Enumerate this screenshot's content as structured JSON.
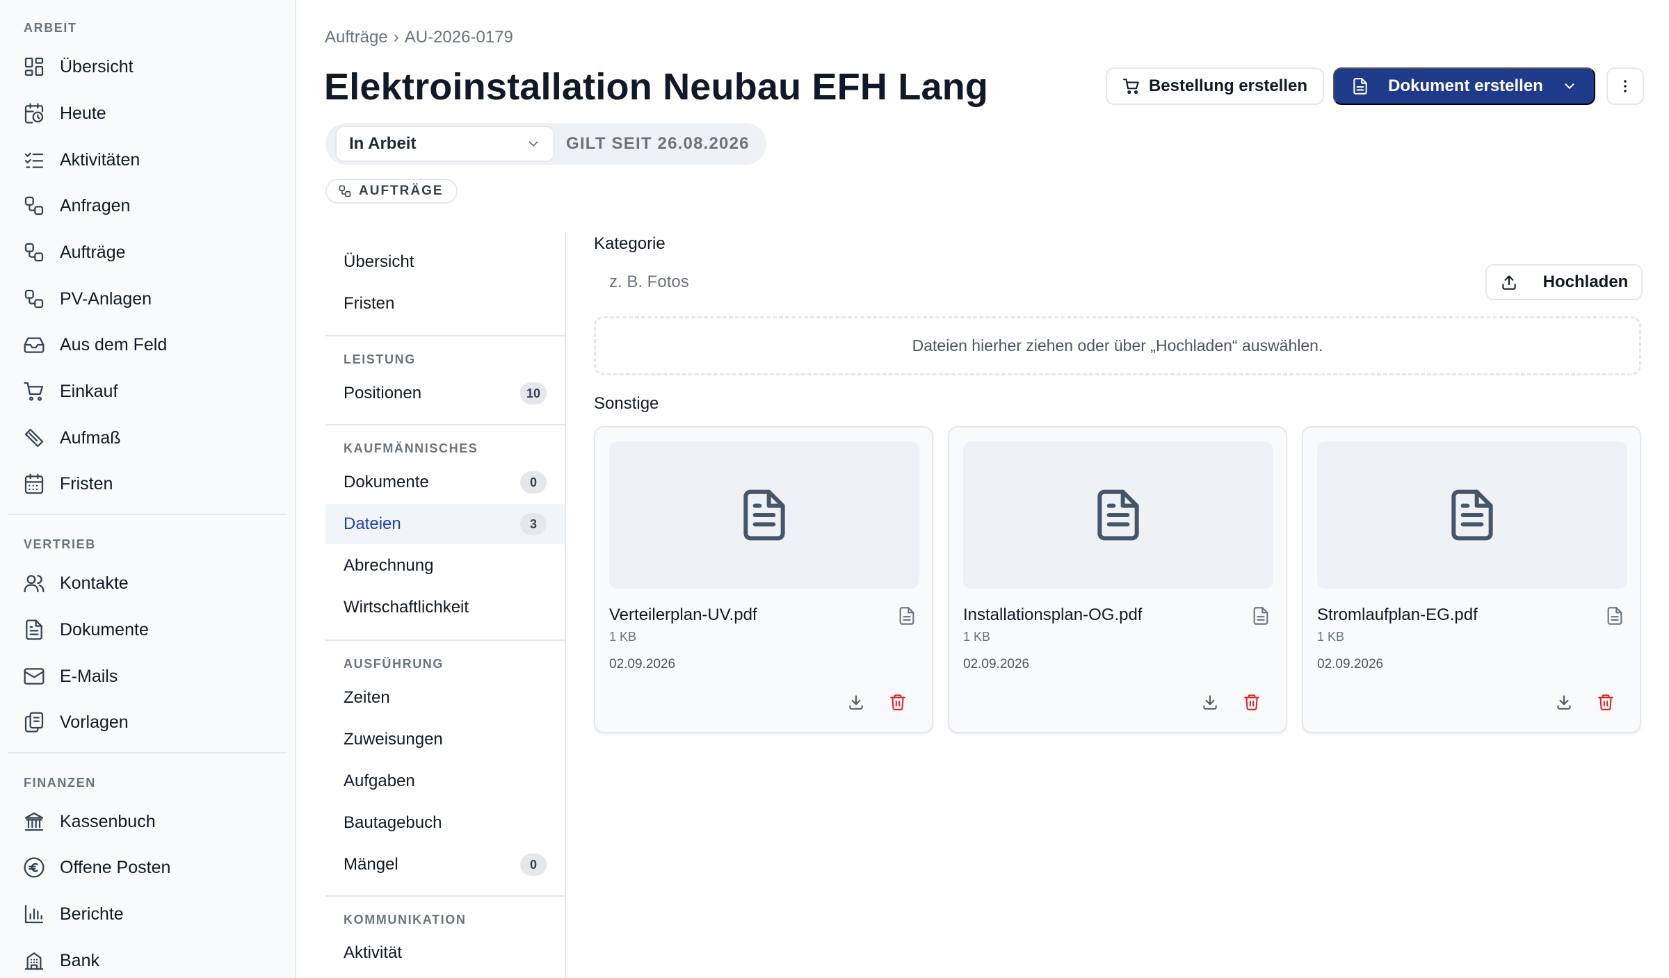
{
  "sidebar": {
    "sections": [
      {
        "title": "ARBEIT",
        "items": [
          {
            "label": "Übersicht",
            "icon": "dashboard-icon"
          },
          {
            "label": "Heute",
            "icon": "calendar-clock-icon"
          },
          {
            "label": "Aktivitäten",
            "icon": "checklist-icon"
          },
          {
            "label": "Anfragen",
            "icon": "workflow-icon"
          },
          {
            "label": "Aufträge",
            "icon": "workflow-icon"
          },
          {
            "label": "PV-Anlagen",
            "icon": "workflow-icon"
          },
          {
            "label": "Aus dem Feld",
            "icon": "inbox-icon"
          },
          {
            "label": "Einkauf",
            "icon": "cart-icon"
          },
          {
            "label": "Aufmaß",
            "icon": "ruler-icon"
          },
          {
            "label": "Fristen",
            "icon": "calendar-icon"
          }
        ]
      },
      {
        "title": "VERTRIEB",
        "items": [
          {
            "label": "Kontakte",
            "icon": "users-icon"
          },
          {
            "label": "Dokumente",
            "icon": "document-icon"
          },
          {
            "label": "E-Mails",
            "icon": "mail-icon"
          },
          {
            "label": "Vorlagen",
            "icon": "copy-icon"
          }
        ]
      },
      {
        "title": "FINANZEN",
        "items": [
          {
            "label": "Kassenbuch",
            "icon": "bank-icon"
          },
          {
            "label": "Offene Posten",
            "icon": "euro-icon"
          },
          {
            "label": "Berichte",
            "icon": "bar-chart-icon"
          },
          {
            "label": "Bank",
            "icon": "building-icon"
          }
        ]
      }
    ]
  },
  "header": {
    "breadcrumb": {
      "parent": "Aufträge",
      "separator": "›",
      "current": "AU-2026-0179"
    },
    "title": "Elektroinstallation Neubau EFH Lang",
    "order_button": "Bestellung erstellen",
    "document_button": "Dokument erstellen",
    "status": {
      "value": "In Arbeit",
      "since": "GILT SEIT 26.08.2026"
    },
    "type_chip": "AUFTRÄGE"
  },
  "subnav": {
    "top": [
      {
        "label": "Übersicht"
      },
      {
        "label": "Fristen"
      }
    ],
    "sections": [
      {
        "title": "LEISTUNG",
        "items": [
          {
            "label": "Positionen",
            "badge": "10"
          }
        ]
      },
      {
        "title": "KAUFMÄNNISCHES",
        "items": [
          {
            "label": "Dokumente",
            "badge": "0"
          },
          {
            "label": "Dateien",
            "badge": "3",
            "active": true
          },
          {
            "label": "Abrechnung"
          },
          {
            "label": "Wirtschaftlichkeit"
          }
        ]
      },
      {
        "title": "AUSFÜHRUNG",
        "items": [
          {
            "label": "Zeiten"
          },
          {
            "label": "Zuweisungen"
          },
          {
            "label": "Aufgaben"
          },
          {
            "label": "Bautagebuch"
          },
          {
            "label": "Mängel",
            "badge": "0"
          }
        ]
      },
      {
        "title": "KOMMUNIKATION",
        "items": [
          {
            "label": "Aktivität"
          }
        ]
      }
    ]
  },
  "files": {
    "category_label": "Kategorie",
    "category_placeholder": "z. B. Fotos",
    "upload_button": "Hochladen",
    "dropzone_text": "Dateien hierher ziehen oder über „Hochladen“ auswählen.",
    "group_label": "Sonstige",
    "items": [
      {
        "name": "Verteilerplan-UV.pdf",
        "size": "1 KB",
        "date": "02.09.2026"
      },
      {
        "name": "Installationsplan-OG.pdf",
        "size": "1 KB",
        "date": "02.09.2026"
      },
      {
        "name": "Stromlaufplan-EG.pdf",
        "size": "1 KB",
        "date": "02.09.2026"
      }
    ]
  },
  "colors": {
    "primary": "#1e3a8a",
    "active_nav_text": "#1e40af",
    "delete": "#dc2626",
    "border": "#e5e7eb",
    "sidebar_bg": "#f8fafc"
  }
}
